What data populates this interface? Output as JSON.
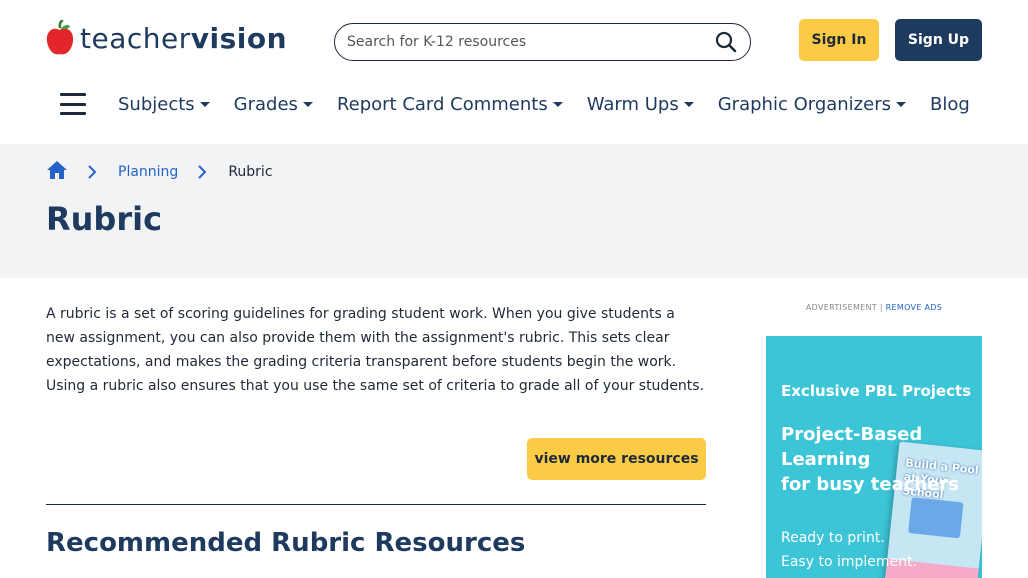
{
  "header": {
    "logo": {
      "part1": "teacher",
      "part2": "vision"
    },
    "search": {
      "placeholder": "Search for K-12 resources"
    },
    "sign_in": "Sign In",
    "sign_up": "Sign Up"
  },
  "nav": {
    "items": [
      {
        "label": "Subjects",
        "dropdown": true
      },
      {
        "label": "Grades",
        "dropdown": true
      },
      {
        "label": "Report Card Comments",
        "dropdown": true
      },
      {
        "label": "Warm Ups",
        "dropdown": true
      },
      {
        "label": "Graphic Organizers",
        "dropdown": true
      },
      {
        "label": "Blog",
        "dropdown": false
      }
    ]
  },
  "breadcrumb": {
    "items": [
      "Planning",
      "Rubric"
    ]
  },
  "page": {
    "title": "Rubric",
    "description": "A rubric is a set of scoring guidelines for grading student work. When you give students a new assignment, you can also provide them with the assignment's rubric. This sets clear expectations, and makes the grading criteria transparent before students begin the work. Using a rubric also ensures that you use the same set of criteria to grade all of your students.",
    "more_button": "view more resources",
    "recommended_title": "Recommended Rubric Resources"
  },
  "ad": {
    "label": "ADVERTISEMENT |",
    "remove": "REMOVE ADS",
    "heading": "Exclusive PBL Projects",
    "headline_lines": [
      "Project-Based",
      "Learning",
      "for busy teachers"
    ],
    "body_lines": [
      "Ready to print.",
      "Easy to implement."
    ],
    "book_title": "Build a Pool at Your School"
  },
  "colors": {
    "brand_navy": "#1e3a5f",
    "accent_yellow": "#fbcb45",
    "link_blue": "#2563c9",
    "ad_teal": "#3cc5d6",
    "apple_red": "#e3262a"
  }
}
